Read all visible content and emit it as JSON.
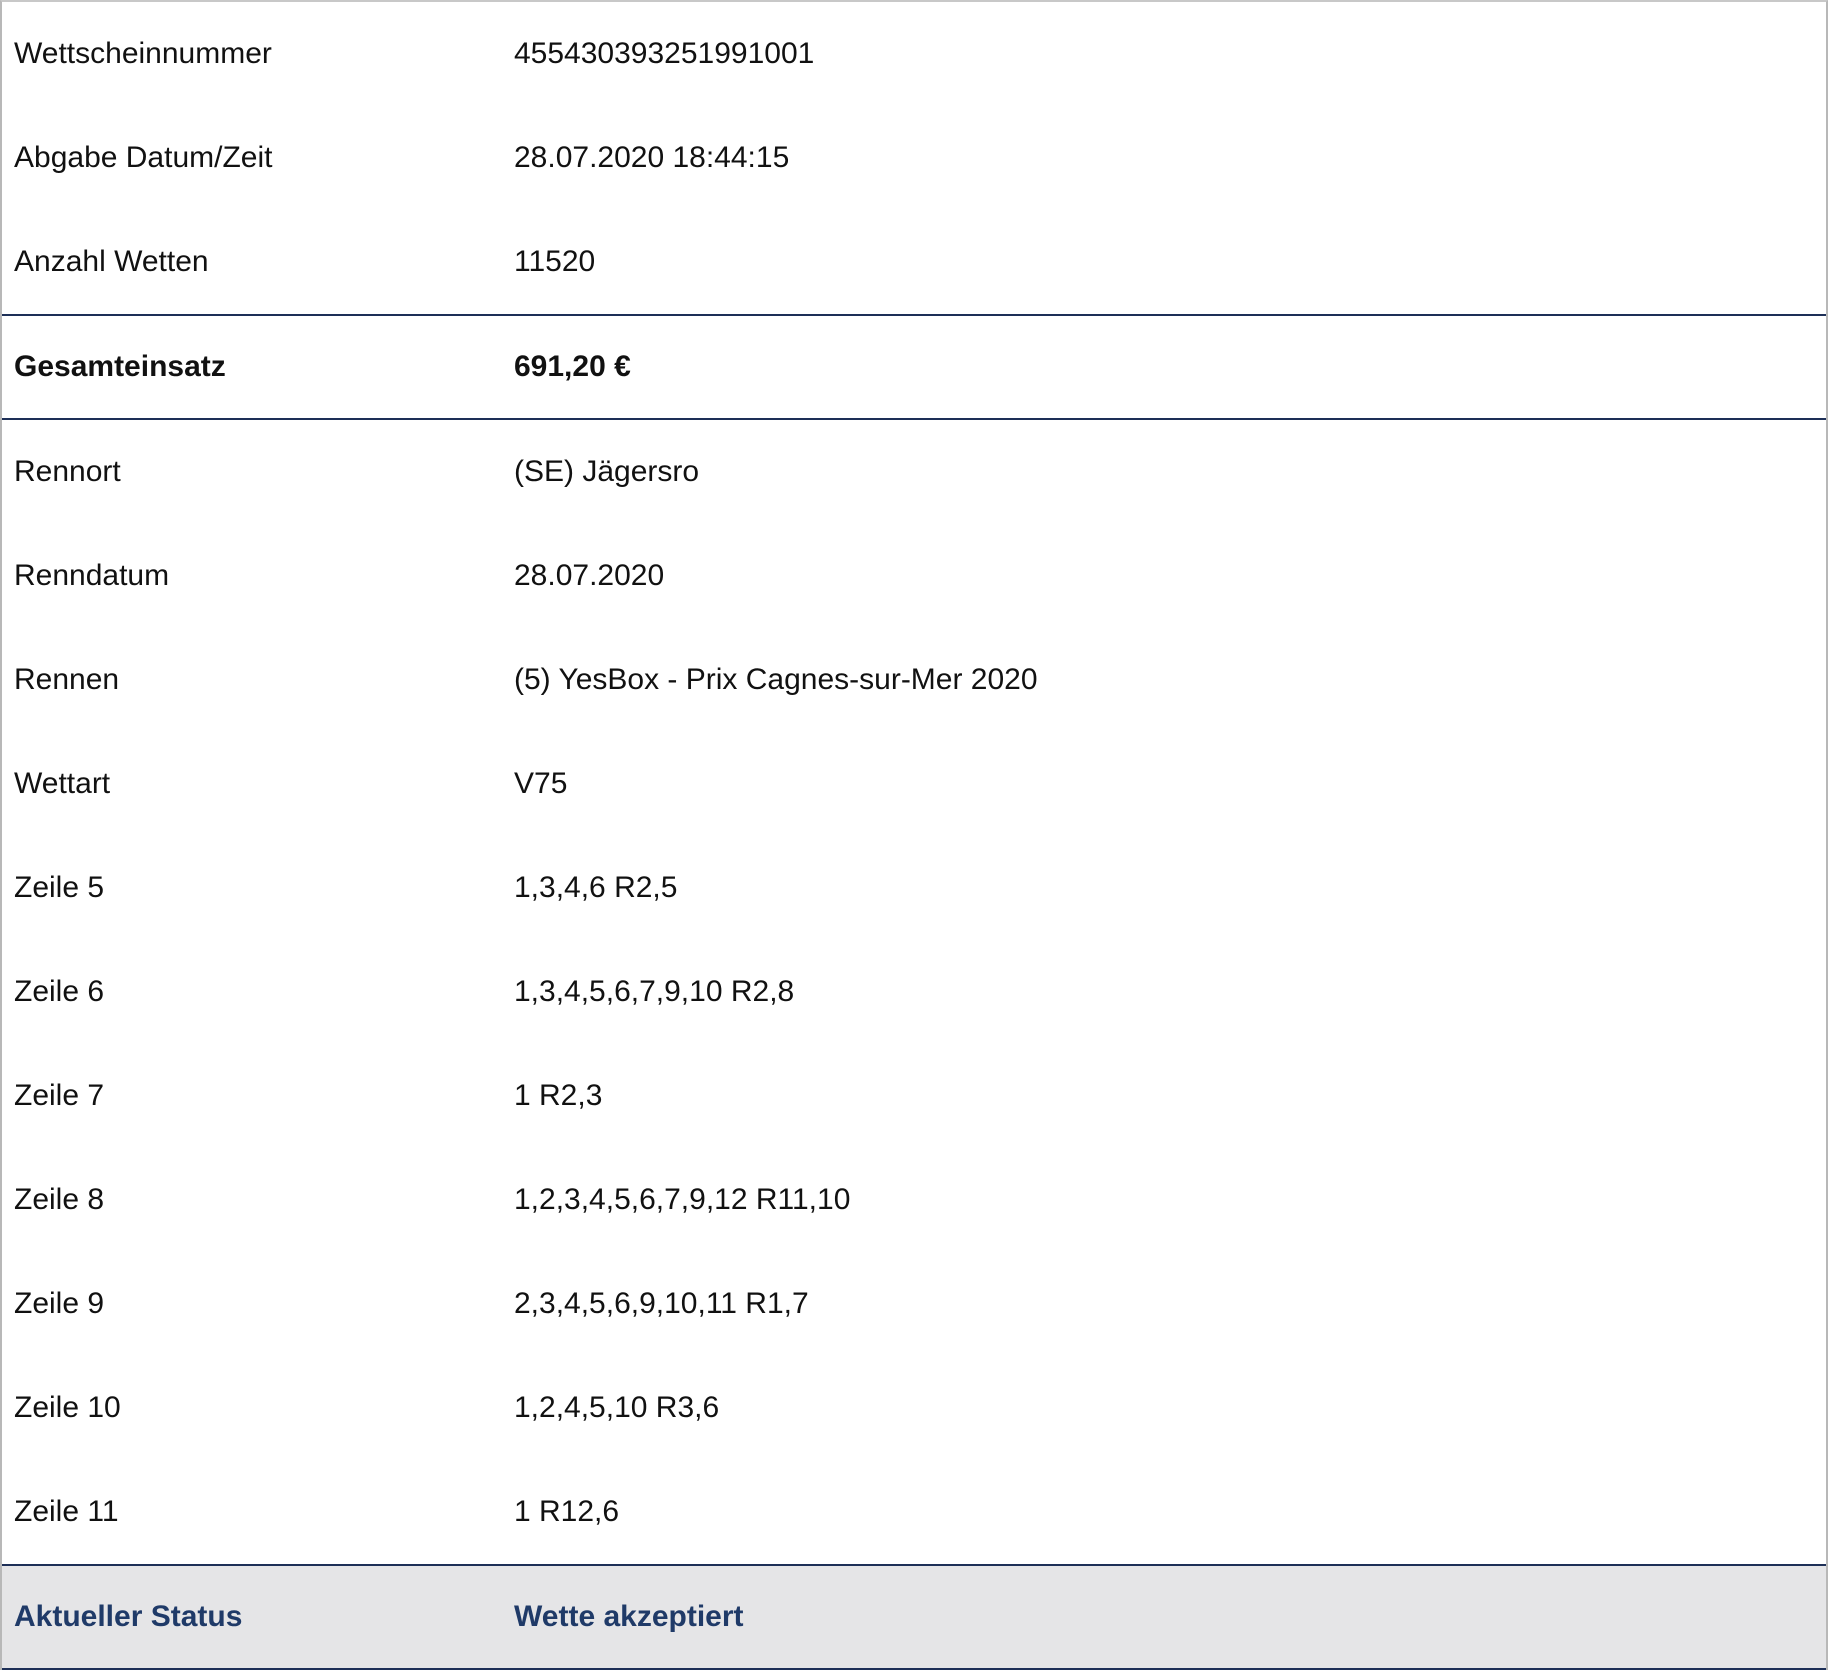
{
  "ticket": {
    "header_rows": [
      {
        "label": "Wettscheinnummer",
        "value": "455430393251991001"
      },
      {
        "label": "Abgabe Datum/Zeit",
        "value": "28.07.2020 18:44:15"
      },
      {
        "label": "Anzahl Wetten",
        "value": "11520"
      }
    ],
    "total": {
      "label": "Gesamteinsatz",
      "value": "691,20 €"
    },
    "detail_rows": [
      {
        "label": "Rennort",
        "value": "(SE) Jägersro"
      },
      {
        "label": "Renndatum",
        "value": "28.07.2020"
      },
      {
        "label": "Rennen",
        "value": "(5) YesBox - Prix Cagnes-sur-Mer 2020"
      },
      {
        "label": "Wettart",
        "value": "V75"
      },
      {
        "label": "Zeile 5",
        "value": "1,3,4,6 R2,5"
      },
      {
        "label": "Zeile 6",
        "value": "1,3,4,5,6,7,9,10 R2,8"
      },
      {
        "label": "Zeile 7",
        "value": "1 R2,3"
      },
      {
        "label": "Zeile 8",
        "value": "1,2,3,4,5,6,7,9,12 R11,10"
      },
      {
        "label": "Zeile 9",
        "value": "2,3,4,5,6,9,10,11 R1,7"
      },
      {
        "label": "Zeile 10",
        "value": "1,2,4,5,10 R3,6"
      },
      {
        "label": "Zeile 11",
        "value": "1 R12,6"
      }
    ],
    "status": {
      "label": "Aktueller Status",
      "value": "Wette akzeptiert"
    }
  },
  "colors": {
    "divider": "#1d2f57",
    "status_text": "#1f3a68",
    "status_background": "#e5e5e7"
  }
}
